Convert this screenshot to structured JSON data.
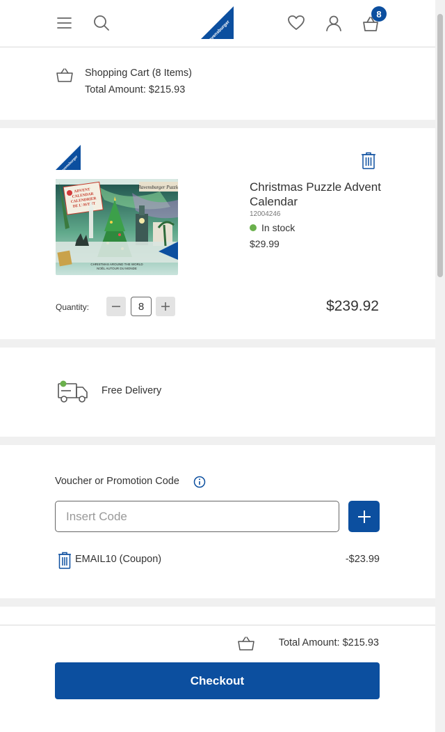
{
  "header": {
    "menu_icon": "hamburger-menu-icon",
    "search_icon": "search-icon",
    "logo_text": "Ravensburger",
    "wishlist_icon": "heart-icon",
    "account_icon": "user-icon",
    "cart_icon": "basket-icon",
    "cart_count": "8"
  },
  "summary": {
    "title": "Shopping Cart (8 Items)",
    "total": "Total Amount: $215.93"
  },
  "item": {
    "brand_badge_text": "Ravensburger",
    "name": "Christmas Puzzle Advent Calendar",
    "sku": "12004246",
    "stock": "In stock",
    "price": "$29.99",
    "quantity_label": "Quantity:",
    "quantity": "8",
    "line_total": "$239.92",
    "image": {
      "box_lines": [
        "ADVENT",
        "CALENDAR",
        "CALENDRIER",
        "DE L'AVENT"
      ],
      "brand": "Ravensburger Puzzle",
      "tagline_1": "CHRISTMAS AROUND THE WORLD",
      "tagline_2": "NOËL AUTOUR DU MONDE"
    }
  },
  "delivery": {
    "label": "Free Delivery"
  },
  "voucher": {
    "label": "Voucher or Promotion Code",
    "placeholder": "Insert Code",
    "value": "",
    "coupon_name": "EMAIL10 (Coupon)",
    "coupon_amount": "-$23.99"
  },
  "footer": {
    "total": "Total Amount: $215.93",
    "checkout_label": "Checkout"
  },
  "colors": {
    "brand_blue": "#0c4f9f",
    "in_stock_green": "#6ab04c",
    "divider_gray": "#f0f0f0"
  }
}
